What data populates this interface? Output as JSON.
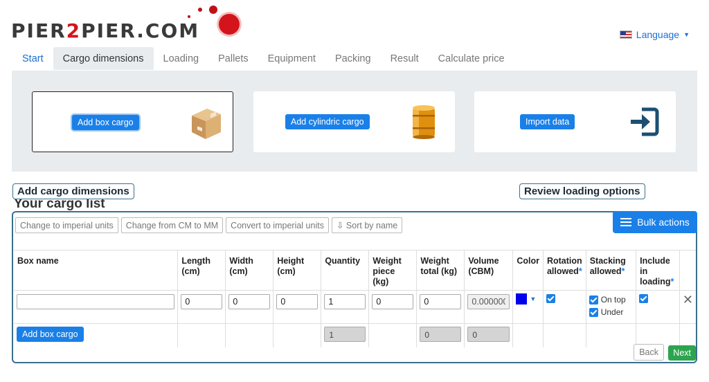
{
  "header": {
    "logo_pre": "PIER",
    "logo_mid": "2",
    "logo_post": "PIER.COM",
    "language_label": "Language"
  },
  "tabs": [
    {
      "label": "Start"
    },
    {
      "label": "Cargo dimensions"
    },
    {
      "label": "Loading"
    },
    {
      "label": "Pallets"
    },
    {
      "label": "Equipment"
    },
    {
      "label": "Packing"
    },
    {
      "label": "Result"
    },
    {
      "label": "Calculate price"
    }
  ],
  "options": {
    "box_label": "Add box cargo",
    "cylinder_label": "Add cylindric cargo",
    "import_label": "Import data"
  },
  "annotations": {
    "left": "Add cargo dimensions",
    "right": "Review loading options"
  },
  "list": {
    "title": "Your cargo list",
    "toolbar": {
      "imperial": "Change to imperial units",
      "cm_mm": "Change from CM to MM",
      "convert": "Convert to imperial units",
      "sort": "Sort by name"
    },
    "bulk_label": "Bulk actions",
    "columns": {
      "box_name": "Box name",
      "length_1": "Length",
      "length_2": "(cm)",
      "width_1": "Width",
      "width_2": "(cm)",
      "height_1": "Height",
      "height_2": "(cm)",
      "quantity": "Quantity",
      "wpiece_1": "Weight",
      "wpiece_2": "piece (kg)",
      "wtotal_1": "Weight",
      "wtotal_2": "total (kg)",
      "volume_1": "Volume",
      "volume_2": "(CBM)",
      "color": "Color",
      "rotation_1": "Rotation",
      "rotation_2": "allowed",
      "stacking_1": "Stacking",
      "stacking_2": "allowed",
      "include_1": "Include in",
      "include_2": "loading",
      "star": "*"
    },
    "row": {
      "box_name": "",
      "length": "0",
      "width": "0",
      "height": "0",
      "quantity": "1",
      "weight_piece": "0",
      "weight_total": "0",
      "volume": "0.000000",
      "color": "#0000ee",
      "on_top_label": "On top",
      "under_label": "Under"
    },
    "totals": {
      "add_label": "Add box cargo",
      "quantity": "1",
      "weight": "0",
      "volume": "0"
    },
    "back_label": "Back",
    "next_label": "Next"
  }
}
